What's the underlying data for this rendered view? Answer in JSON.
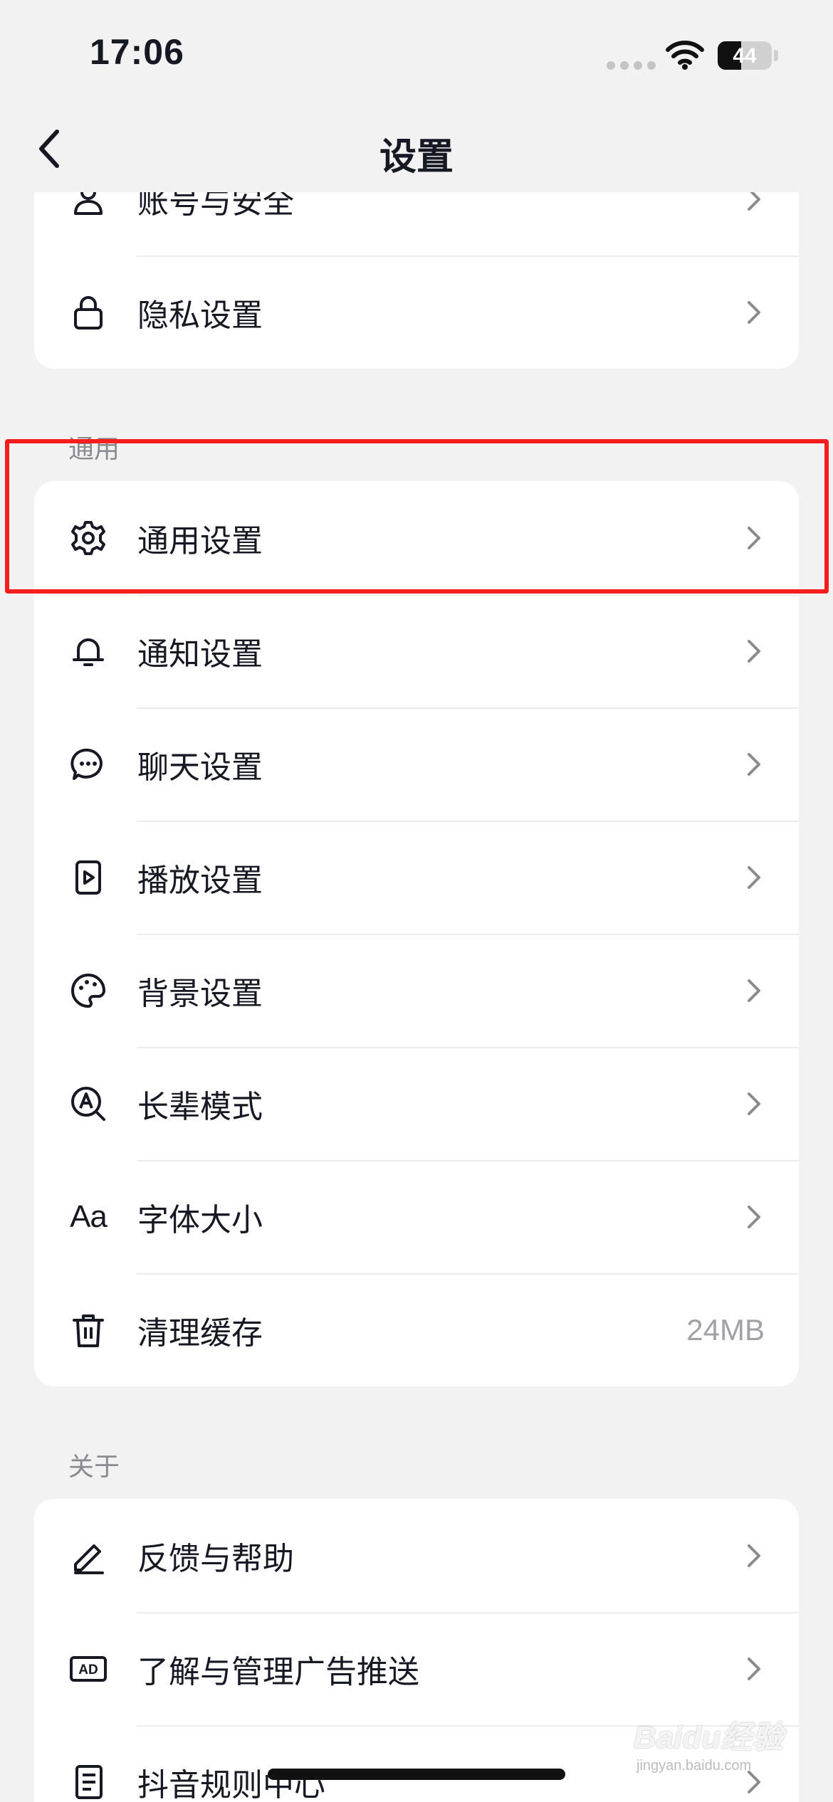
{
  "status_bar": {
    "time": "17:06",
    "battery_percent": "44",
    "battery_level": 0.44
  },
  "header": {
    "title": "设置",
    "back_icon": "chevron-left-icon"
  },
  "top_section": {
    "items": [
      {
        "label": "账号与安全",
        "icon": "user-icon"
      },
      {
        "label": "隐私设置",
        "icon": "lock-icon"
      }
    ]
  },
  "general_section": {
    "header": "通用",
    "items": [
      {
        "label": "通用设置",
        "icon": "gear-icon"
      },
      {
        "label": "通知设置",
        "icon": "bell-icon"
      },
      {
        "label": "聊天设置",
        "icon": "chat-bubble-icon"
      },
      {
        "label": "播放设置",
        "icon": "play-icon"
      },
      {
        "label": "背景设置",
        "icon": "palette-icon"
      },
      {
        "label": "长辈模式",
        "icon": "elder-mode-icon"
      },
      {
        "label": "字体大小",
        "icon": "font-size-icon",
        "glyph": "Aa"
      },
      {
        "label": "清理缓存",
        "icon": "trash-icon",
        "value": "24MB"
      }
    ]
  },
  "about_section": {
    "header": "关于",
    "items": [
      {
        "label": "反馈与帮助",
        "icon": "edit-icon"
      },
      {
        "label": "了解与管理广告推送",
        "icon": "ad-icon",
        "glyph": "AD"
      },
      {
        "label": "抖音规则中心",
        "icon": "document-icon"
      }
    ]
  },
  "watermark": {
    "brand": "Baidu经验",
    "site": "jingyan.baidu.com"
  },
  "colors": {
    "background": "#f2f2f2",
    "card": "#ffffff",
    "text": "#161823",
    "secondary_text": "#8a8b91",
    "highlight": "#f41e1e"
  }
}
